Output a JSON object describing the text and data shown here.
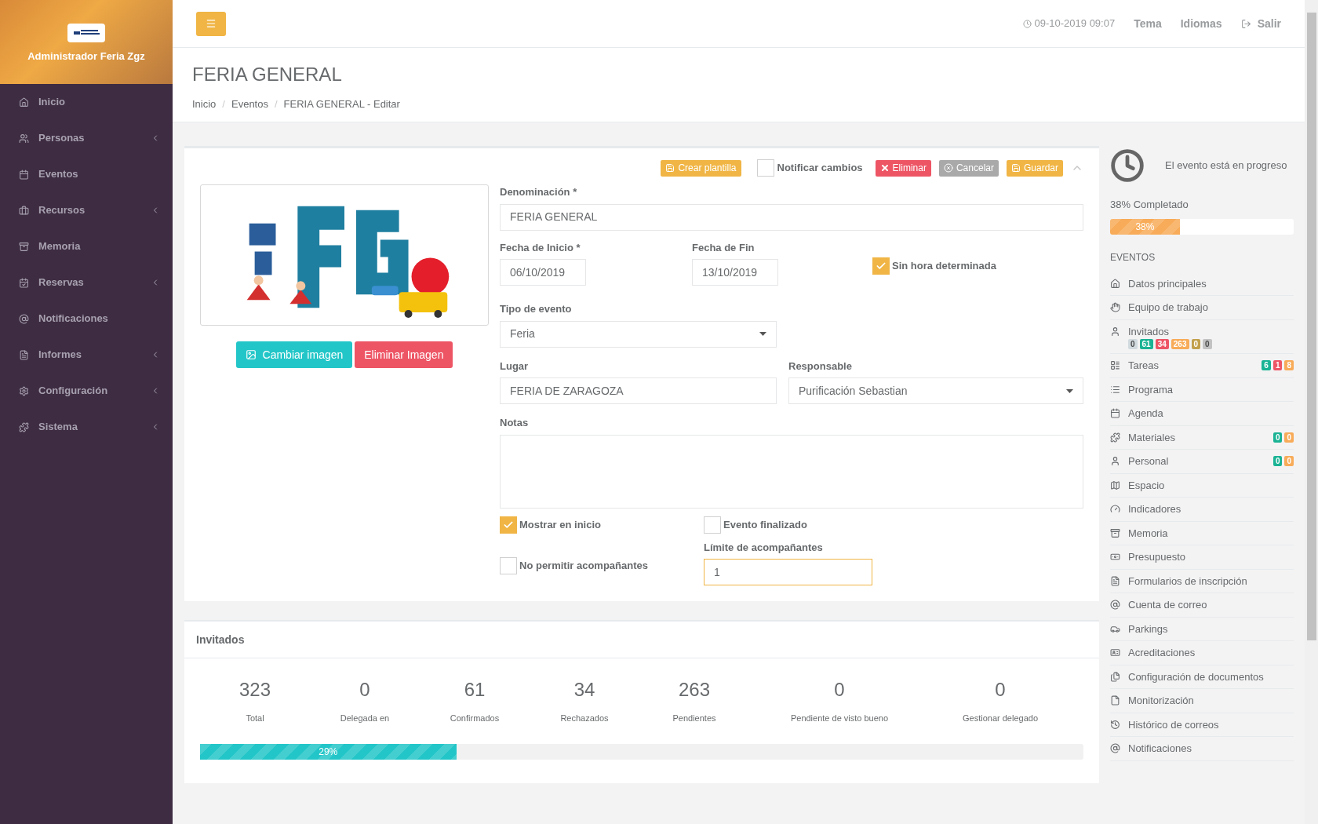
{
  "sidebar": {
    "user": "Administrador Feria Zgz",
    "items": [
      {
        "label": "Inicio",
        "submenu": false
      },
      {
        "label": "Personas",
        "submenu": true
      },
      {
        "label": "Eventos",
        "submenu": false
      },
      {
        "label": "Recursos",
        "submenu": true
      },
      {
        "label": "Memoria",
        "submenu": false
      },
      {
        "label": "Reservas",
        "submenu": true
      },
      {
        "label": "Notificaciones",
        "submenu": false
      },
      {
        "label": "Informes",
        "submenu": true
      },
      {
        "label": "Configuración",
        "submenu": true
      },
      {
        "label": "Sistema",
        "submenu": true
      }
    ]
  },
  "topbar": {
    "datetime": "09-10-2019 09:07",
    "links": [
      "Tema",
      "Idiomas"
    ],
    "logout": "Salir"
  },
  "page": {
    "title": "FERIA GENERAL",
    "breadcrumb_separator": "/",
    "breadcrumb": [
      "Inicio",
      "Eventos",
      "FERIA GENERAL - Editar"
    ]
  },
  "toolbar": {
    "template_button": "Crear plantilla",
    "notify": {
      "label": "Notificar cambios",
      "checked": false
    },
    "buttons": [
      {
        "label": "Eliminar",
        "kind": "danger"
      },
      {
        "label": "Cancelar",
        "kind": "cancel"
      },
      {
        "label": "Guardar",
        "kind": "save"
      }
    ]
  },
  "image_buttons": [
    {
      "label": "Cambiar imagen",
      "kind": "change"
    },
    {
      "label": "Eliminar Imagen",
      "kind": "delete"
    }
  ],
  "form": {
    "name": {
      "label": "Denominación *",
      "value": "FERIA GENERAL"
    },
    "start": {
      "label": "Fecha de Inicio *",
      "value": "06/10/2019"
    },
    "end": {
      "label": "Fecha de Fin",
      "value": "13/10/2019"
    },
    "no_time": {
      "label": "Sin hora determinada",
      "checked": true
    },
    "type": {
      "label": "Tipo de evento",
      "value": "Feria"
    },
    "place": {
      "label": "Lugar",
      "value": "FERIA DE ZARAGOZA"
    },
    "owner": {
      "label": "Responsable",
      "value": "Purificación Sebastian"
    },
    "notes": {
      "label": "Notas"
    },
    "show_home": {
      "label": "Mostrar en inicio",
      "checked": true
    },
    "finished": {
      "label": "Evento finalizado",
      "checked": false
    },
    "no_companions": {
      "label": "No permitir acompañantes",
      "checked": false
    },
    "companion_limit": {
      "label": "Límite de acompañantes",
      "value": "1"
    }
  },
  "invitados": {
    "title": "Invitados",
    "stats": [
      {
        "value": "323",
        "label": "Total"
      },
      {
        "value": "0",
        "label": "Delegada en"
      },
      {
        "value": "61",
        "label": "Confirmados"
      },
      {
        "value": "34",
        "label": "Rechazados"
      },
      {
        "value": "263",
        "label": "Pendientes"
      },
      {
        "value": "0",
        "label": "Pendiente de visto bueno"
      },
      {
        "value": "0",
        "label": "Gestionar delegado"
      }
    ],
    "progress": {
      "level": 0.29,
      "reading": "29%"
    }
  },
  "status": {
    "text": "El evento está en progreso",
    "completed": "38% Completado",
    "progress": {
      "level": 0.38,
      "reading": "38%"
    }
  },
  "events_menu": {
    "title": "EVENTOS",
    "items": [
      {
        "label": "Datos principales"
      },
      {
        "label": "Equipo de trabajo"
      },
      {
        "label": "Invitados",
        "badges": [
          {
            "text": "0",
            "color": "#d1dade"
          },
          {
            "text": "61",
            "color": "#1ab394"
          },
          {
            "text": "34",
            "color": "#ed5565"
          },
          {
            "text": "263",
            "color": "#f8ac59"
          },
          {
            "text": "0",
            "color": "#c2a14d"
          },
          {
            "text": "0",
            "color": "#c2c2c2"
          }
        ]
      },
      {
        "label": "Tareas",
        "badges": [
          {
            "text": "6",
            "color": "#1ab394"
          },
          {
            "text": "1",
            "color": "#ed5565"
          },
          {
            "text": "8",
            "color": "#f8ac59"
          }
        ]
      },
      {
        "label": "Programa"
      },
      {
        "label": "Agenda"
      },
      {
        "label": "Materiales",
        "badges": [
          {
            "text": "0",
            "color": "#1ab394"
          },
          {
            "text": "0",
            "color": "#f8ac59"
          }
        ]
      },
      {
        "label": "Personal",
        "badges": [
          {
            "text": "0",
            "color": "#1ab394"
          },
          {
            "text": "0",
            "color": "#f8ac59"
          }
        ]
      },
      {
        "label": "Espacio"
      },
      {
        "label": "Indicadores"
      },
      {
        "label": "Memoria"
      },
      {
        "label": "Presupuesto"
      },
      {
        "label": "Formularios de inscripción"
      },
      {
        "label": "Cuenta de correo"
      },
      {
        "label": "Parkings"
      },
      {
        "label": "Acreditaciones"
      },
      {
        "label": "Configuración de documentos"
      },
      {
        "label": "Monitorización"
      },
      {
        "label": "Histórico de correos"
      },
      {
        "label": "Notificaciones"
      }
    ]
  }
}
